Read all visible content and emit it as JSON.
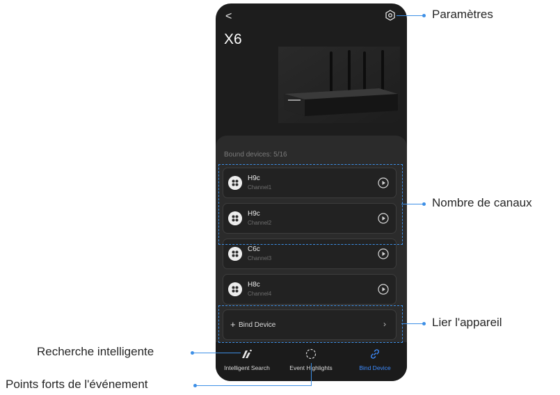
{
  "app": {
    "back_icon": "chevron-left-icon",
    "title": "X6",
    "settings_icon": "settings-icon"
  },
  "bound_devices": "Bound devices: 5/16",
  "devices": [
    {
      "name": "H9c",
      "channel": "Channel1"
    },
    {
      "name": "H9c",
      "channel": "Channel2"
    },
    {
      "name": "C6c",
      "channel": "Channel3"
    },
    {
      "name": "H8c",
      "channel": "Channel4"
    }
  ],
  "bind_device": {
    "label": "Bind Device",
    "plus": "+",
    "chevron": "›"
  },
  "nav": {
    "items": [
      {
        "label": "Intelligent Search",
        "icon": "intelligent-search-icon"
      },
      {
        "label": "Event Highlights",
        "icon": "event-highlights-icon"
      },
      {
        "label": "Bind Device",
        "icon": "link-icon"
      }
    ],
    "active_color": "#3d8cff"
  },
  "callouts": {
    "settings": "Paramètres",
    "channels": "Nombre de canaux",
    "bind": "Lier l'appareil",
    "search": "Recherche intelligente",
    "highlights": "Points forts de l'événement"
  },
  "colors": {
    "accent": "#3d8fe6",
    "phone_bg": "#1d1d1d",
    "panel_bg": "#2b2b2b"
  }
}
